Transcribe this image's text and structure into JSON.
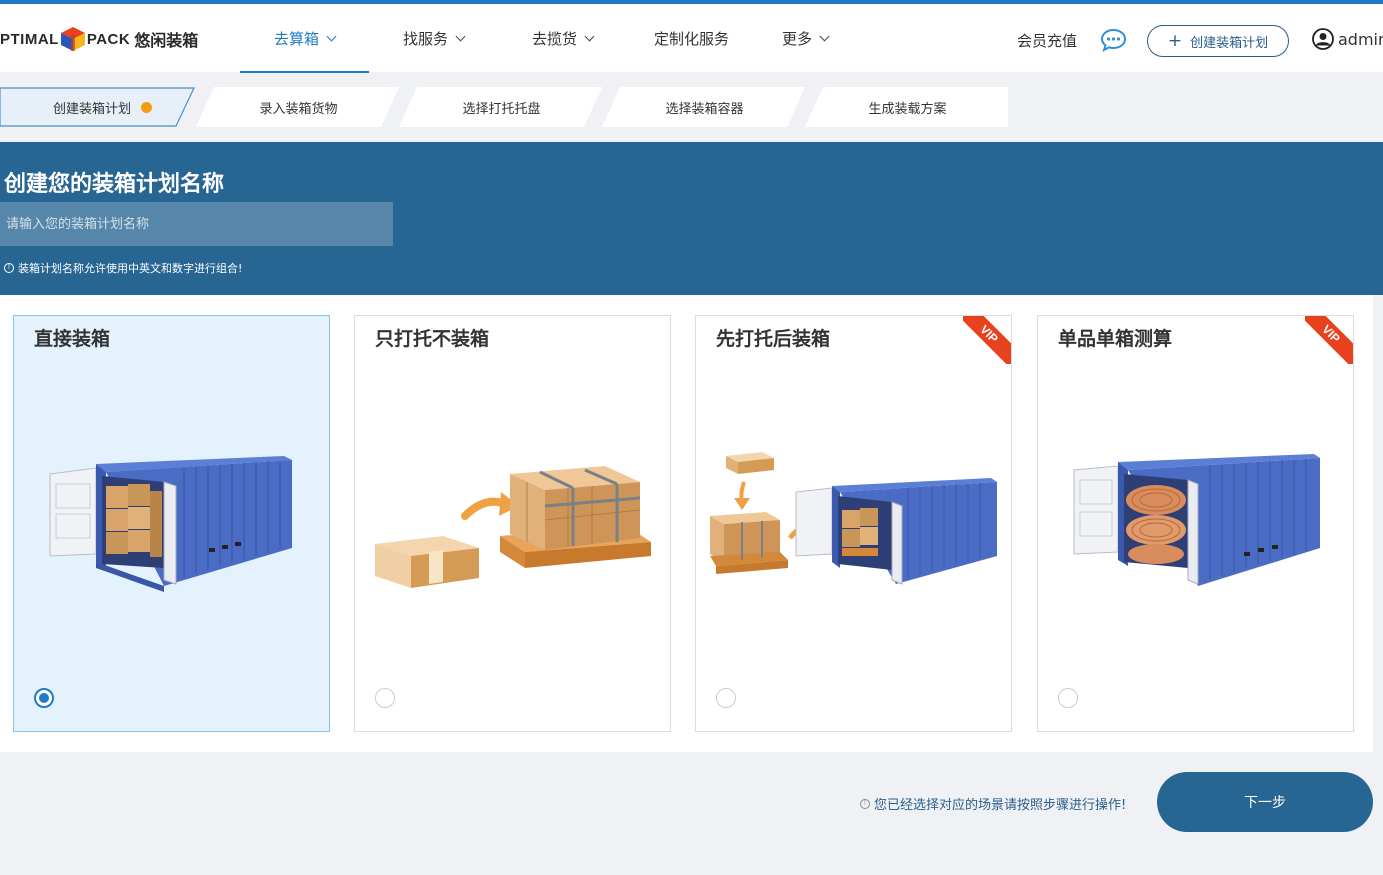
{
  "app": {
    "logo_left": "PTIMAL",
    "logo_right": "PACK",
    "logo_cn": "悠闲装箱"
  },
  "nav": {
    "items": [
      {
        "label": "去算箱",
        "dropdown": true,
        "active": true
      },
      {
        "label": "找服务",
        "dropdown": true
      },
      {
        "label": "去揽货",
        "dropdown": true
      },
      {
        "label": "定制化服务",
        "dropdown": false
      },
      {
        "label": "更多",
        "dropdown": true
      }
    ],
    "recharge": "会员充值",
    "create_plan": "创建装箱计划",
    "user": "admin"
  },
  "steps": [
    {
      "label": "创建装箱计划",
      "current": true
    },
    {
      "label": "录入装箱货物"
    },
    {
      "label": "选择打托托盘"
    },
    {
      "label": "选择装箱容器"
    },
    {
      "label": "生成装载方案"
    }
  ],
  "banner": {
    "title": "创建您的装箱计划名称",
    "input_placeholder": "请输入您的装箱计划名称",
    "input_value": "",
    "hint": "装箱计划名称允许使用中英文和数字进行组合!"
  },
  "cards": [
    {
      "title": "直接装箱",
      "selected": true,
      "vip": false,
      "illustration": "container-with-boxes"
    },
    {
      "title": "只打托不装箱",
      "selected": false,
      "vip": false,
      "illustration": "box-to-pallet"
    },
    {
      "title": "先打托后装箱",
      "selected": false,
      "vip": true,
      "illustration": "pallet-into-container"
    },
    {
      "title": "单品单箱测算",
      "selected": false,
      "vip": true,
      "illustration": "container-with-rolls"
    }
  ],
  "vip_label": "VIP",
  "footer": {
    "hint": "您已经选择对应的场景请按照步骤进行操作!",
    "next": "下一步"
  },
  "colors": {
    "accent": "#1f7bc7",
    "banner": "#276593",
    "vip": "#e8411d",
    "step_dot": "#f39c12",
    "container": "#4a6cc4"
  }
}
